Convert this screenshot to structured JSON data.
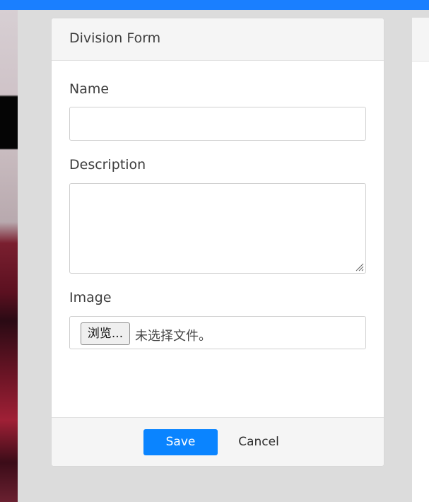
{
  "form": {
    "title": "Division Form",
    "name_label": "Name",
    "name_value": "",
    "description_label": "Description",
    "description_value": "",
    "image_label": "Image",
    "file_button_label": "浏览...",
    "file_status": "未选择文件。"
  },
  "footer": {
    "save_label": "Save",
    "cancel_label": "Cancel"
  },
  "colors": {
    "accent": "#0a84ff",
    "topbar": "#1a7fff"
  }
}
